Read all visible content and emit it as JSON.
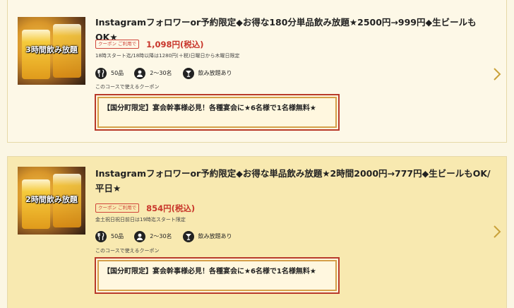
{
  "courses": [
    {
      "thumb_label": "3時間飲み放題",
      "title": "Instagramフォロワーor予約限定◆お得な180分単品飲み放題★2500円→999円◆生ビールもOK★",
      "coupon_tag": "クーポン ご利用で",
      "price": "1,098円(税込)",
      "note": "18時スタート迄/18時以降は1280円(＋税)日曜日から木曜日限定",
      "dishes": "50品",
      "people": "2～30名",
      "drinks": "飲み放題あり",
      "coupon_caption": "このコースで使えるクーポン",
      "coupon_text": "【国分町限定】宴会幹事様必見！各種宴会に★6名様で1名様無料★"
    },
    {
      "thumb_label": "2時間飲み放題",
      "title": "Instagramフォロワーor予約限定◆お得な単品飲み放題★2時間2000円→777円◆生ビールもOK/平日★",
      "coupon_tag": "クーポン ご利用で",
      "price": "854円(税込)",
      "note": "金土祝日祝日前日は19時迄スタート限定",
      "dishes": "50品",
      "people": "2～30名",
      "drinks": "飲み放題あり",
      "coupon_caption": "このコースで使えるクーポン",
      "coupon_text": "【国分町限定】宴会幹事様必見！各種宴会に★6名様で1名様無料★"
    }
  ],
  "colors": {
    "accent": "#c8352a",
    "chevron": "#c9a13a",
    "card1_bg": "#fdf8e7",
    "card2_bg": "#f8e9b0"
  },
  "icons": [
    "fork-knife-icon",
    "person-icon",
    "cocktail-glass-icon",
    "chevron-right-icon"
  ]
}
